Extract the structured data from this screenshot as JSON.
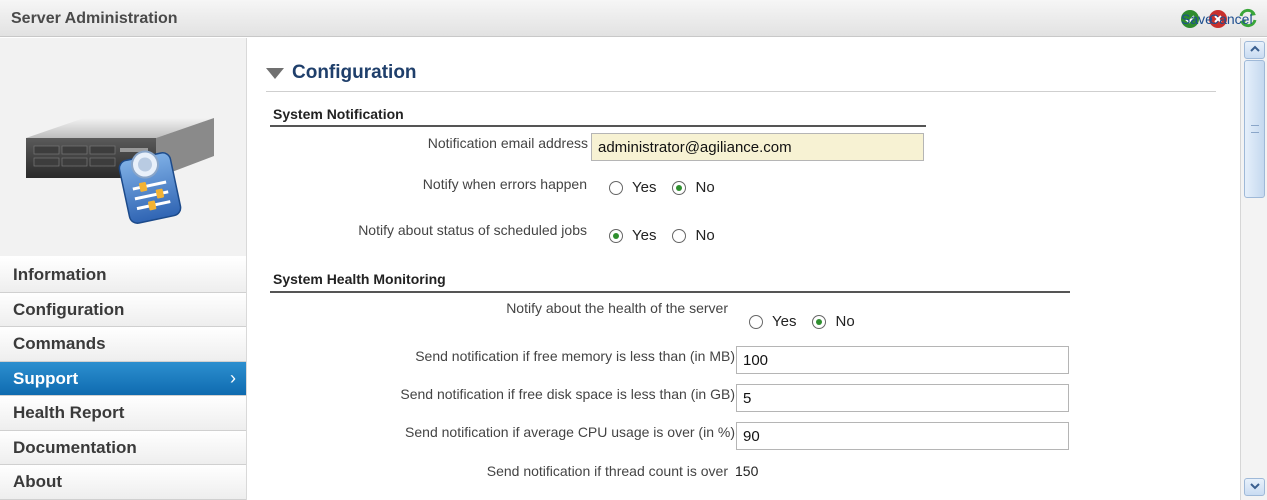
{
  "window": {
    "title": "Server Administration"
  },
  "actions": {
    "save": "Save",
    "cancel": "Cancel"
  },
  "sidebar": {
    "items": [
      {
        "label": "Information",
        "active": false
      },
      {
        "label": "Configuration",
        "active": false
      },
      {
        "label": "Commands",
        "active": false
      },
      {
        "label": "Support",
        "active": true
      },
      {
        "label": "Health Report",
        "active": false
      },
      {
        "label": "Documentation",
        "active": false
      },
      {
        "label": "About",
        "active": false
      }
    ]
  },
  "main": {
    "section_title": "Configuration",
    "system_notification": {
      "title": "System Notification",
      "email_label": "Notification email address",
      "email_value": "administrator@agiliance.com",
      "errors_label": "Notify when errors happen",
      "jobs_label": "Notify about status of scheduled jobs"
    },
    "health": {
      "title": "System Health Monitoring",
      "server_label": "Notify about the health of the server",
      "memory_label": "Send notification if free memory is less than (in MB)",
      "memory_value": "100",
      "disk_label": "Send notification if free disk space is less than (in GB)",
      "disk_value": "5",
      "cpu_label": "Send notification if average CPU usage is over (in %)",
      "cpu_value": "90",
      "thread_label": "Send notification if thread count is over",
      "thread_value": "150"
    },
    "radio": {
      "yes": "Yes",
      "no": "No"
    }
  },
  "colors": {
    "accent": "#1f3f6b",
    "active_nav": "#1a7cc0",
    "save_green": "#2e8b2e",
    "cancel_red": "#c9302c"
  }
}
